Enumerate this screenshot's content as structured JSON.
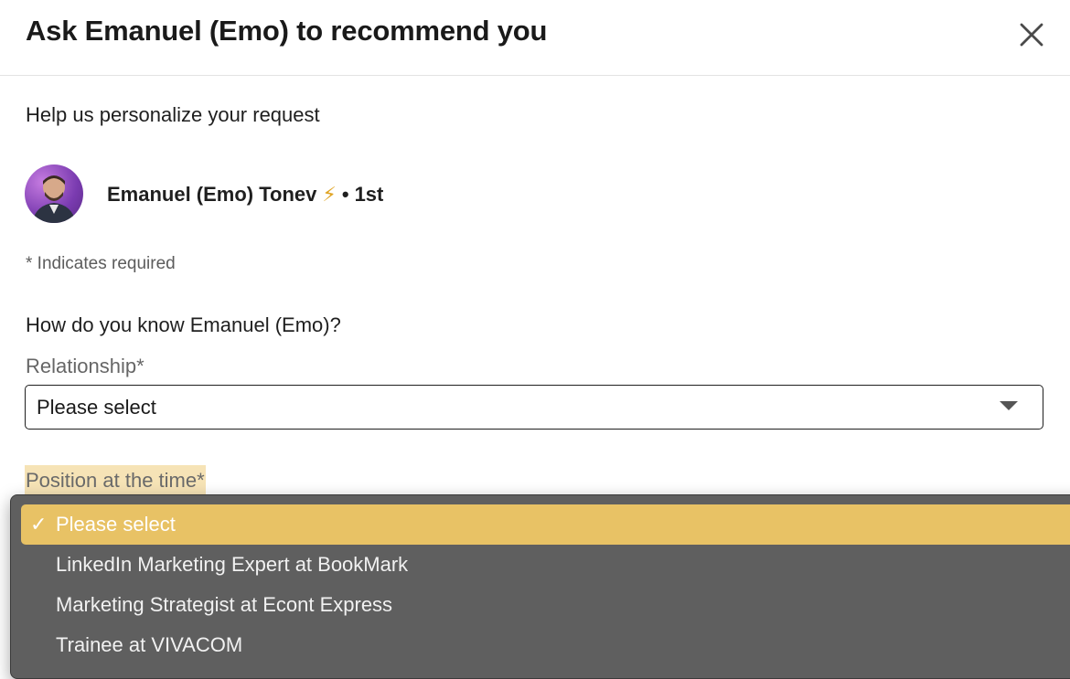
{
  "dialog": {
    "title": "Ask Emanuel (Emo) to recommend you",
    "subtitle": "Help us personalize your request",
    "close_icon": "close-icon"
  },
  "person": {
    "name": "Emanuel (Emo) Tonev",
    "badge_icon": "⚡",
    "connector": "•",
    "degree": "1st"
  },
  "form": {
    "required_note": "* Indicates required",
    "question": "How do you know Emanuel (Emo)?",
    "relationship": {
      "label": "Relationship*",
      "value": "Please select"
    },
    "position": {
      "label": "Position at the time*",
      "options": [
        {
          "label": "Please select",
          "selected": true
        },
        {
          "label": "LinkedIn Marketing Expert at BookMark",
          "selected": false
        },
        {
          "label": "Marketing Strategist at Econt Express",
          "selected": false
        },
        {
          "label": "Trainee at VIVACOM",
          "selected": false
        }
      ],
      "check_mark": "✓"
    }
  },
  "colors": {
    "highlight": "#e8c265",
    "dropdown_bg": "#5f5f5f",
    "label_highlight": "#f6e3b6"
  }
}
